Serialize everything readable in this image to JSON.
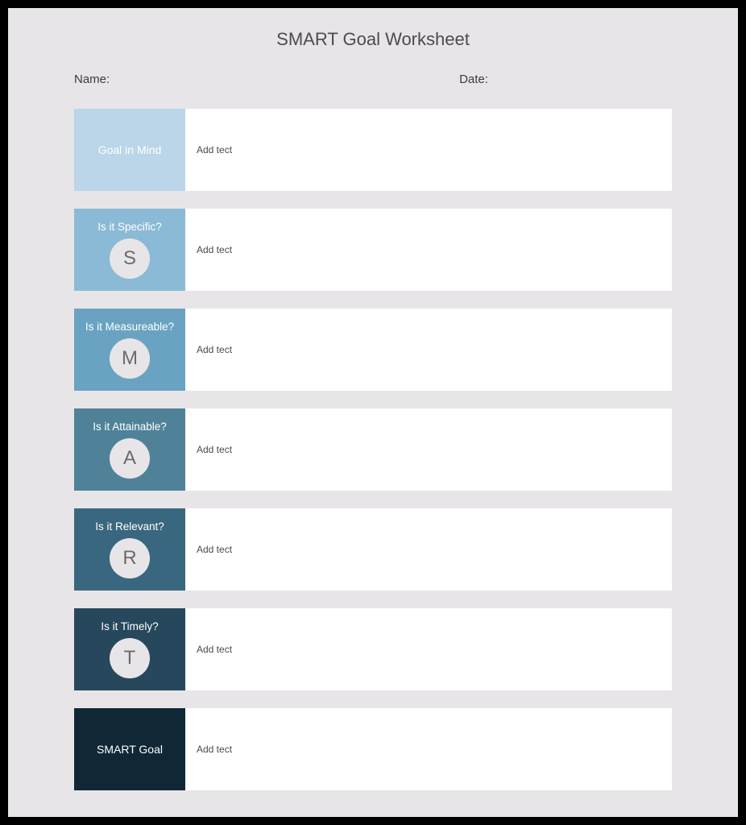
{
  "title": "SMART Goal Worksheet",
  "header": {
    "name_label": "Name:",
    "date_label": "Date:"
  },
  "placeholder": "Add tect",
  "rows": [
    {
      "label": "Goal in Mind",
      "letter": "",
      "color": "#bad6e8"
    },
    {
      "label": "Is it Specific?",
      "letter": "S",
      "color": "#8abad6"
    },
    {
      "label": "Is it Measureable?",
      "letter": "M",
      "color": "#6aa3c1"
    },
    {
      "label": "Is it Attainable?",
      "letter": "A",
      "color": "#4f8299"
    },
    {
      "label": "Is it Relevant?",
      "letter": "R",
      "color": "#3a6780"
    },
    {
      "label": "Is it Timely?",
      "letter": "T",
      "color": "#27485c"
    },
    {
      "label": "SMART Goal",
      "letter": "",
      "color": "#102836"
    }
  ]
}
